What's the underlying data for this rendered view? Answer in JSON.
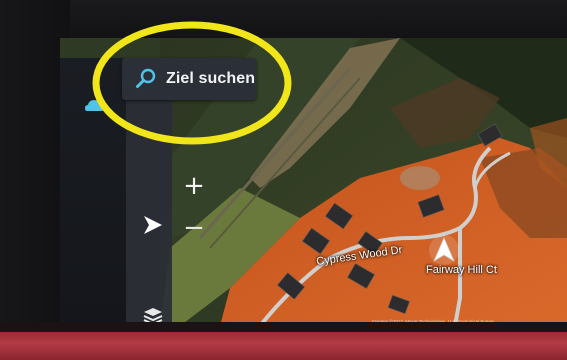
{
  "search": {
    "label": "Ziel suchen",
    "icon": "search-icon"
  },
  "map_controls": {
    "zoom_in_label": "+",
    "zoom_out_label": "−",
    "zoom_in_icon": "plus-icon",
    "zoom_out_icon": "minus-icon",
    "compass_icon": "compass-arrow-icon",
    "layers_icon": "layers-icon",
    "status_icon": "cloud-status-icon"
  },
  "map": {
    "road_labels": [
      "Cypress Wood Dr",
      "Fairway Hill Ct"
    ],
    "attribution": "Imagery ©2017, Maxar Technologies, U.S. Geological Survey"
  },
  "colors": {
    "accent": "#4fc3e8",
    "highlight_ellipse": "#f0e61a",
    "sidebar": "#1a1d23",
    "dashboard": "#a8323c"
  }
}
